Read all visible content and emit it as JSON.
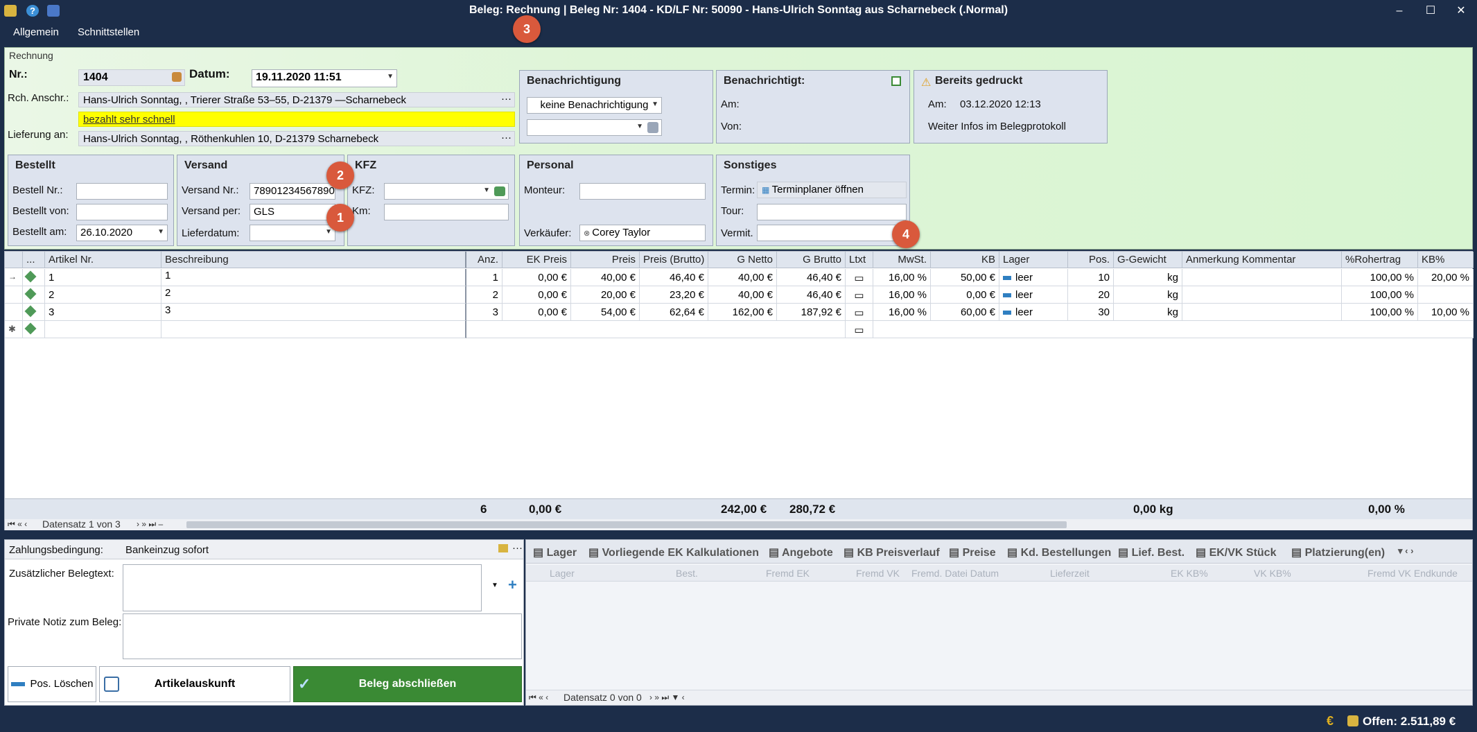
{
  "window": {
    "title": "Beleg: Rechnung | Beleg Nr: 1404 - KD/LF Nr: 50090 - Hans-Ulrich Sonntag aus Scharnebeck (.Normal)",
    "minimize": "–",
    "maximize": "☐",
    "close": "✕"
  },
  "menu": {
    "items": [
      "Allgemein",
      "Schnittstellen"
    ]
  },
  "badges": [
    "1",
    "2",
    "3",
    "4"
  ],
  "header": {
    "section_label": "Rechnung",
    "nr_label": "Nr.:",
    "nr_value": "1404",
    "datum_label": "Datum:",
    "datum_value": "19.11.2020 11:51",
    "rch_label": "Rch. Anschr.:",
    "rch_value": "Hans-Ulrich Sonntag, , Trierer Straße 53–55, D-21379 —Scharnebeck",
    "note_value": "bezahlt sehr schnell",
    "lieferung_label": "Lieferung an:",
    "lieferung_value": "Hans-Ulrich Sonntag, , Röthenkuhlen 10, D-21379 Scharnebeck",
    "ellipsis": "···"
  },
  "benachrichtigung": {
    "title": "Benachrichtigung",
    "select_value": "keine Benachrichtigung"
  },
  "benachrichtigt": {
    "title": "Benachrichtigt:",
    "am_label": "Am:",
    "von_label": "Von:"
  },
  "gedruckt": {
    "title": "Bereits gedruckt",
    "am_label": "Am:",
    "am_value": "03.12.2020 12:13",
    "info": "Weiter Infos im Belegprotokoll"
  },
  "bestellt": {
    "title": "Bestellt",
    "nr_label": "Bestell Nr.:",
    "von_label": "Bestellt von:",
    "am_label": "Bestellt am:",
    "am_value": "26.10.2020"
  },
  "versand": {
    "title": "Versand",
    "nr_label": "Versand Nr.:",
    "nr_value": "78901234567890",
    "per_label": "Versand per:",
    "per_value": "GLS",
    "liefer_label": "Lieferdatum:"
  },
  "kfz": {
    "title": "KFZ",
    "kfz_label": "KFZ:",
    "km_label": "Km:"
  },
  "personal": {
    "title": "Personal",
    "monteur_label": "Monteur:",
    "verkaeufer_label": "Verkäufer:",
    "verkaeufer_value": "Corey Taylor"
  },
  "sonstiges": {
    "title": "Sonstiges",
    "termin_label": "Termin:",
    "termin_value": "Terminplaner öffnen",
    "tour_label": "Tour:",
    "vermit_label": "Vermit."
  },
  "grid": {
    "columns": [
      "...",
      "Artikel Nr.",
      "Beschreibung",
      "Anz.",
      "EK Preis",
      "Preis",
      "Preis (Brutto)",
      "G Netto",
      "G Brutto",
      "Ltxt",
      "MwSt.",
      "KB",
      "Lager",
      "Pos.",
      "G-Gewicht",
      "Anmerkung Kommentar",
      "%Rohertrag",
      "KB%"
    ],
    "rows": [
      {
        "artikel": "1",
        "beschreibung": "1",
        "anz": "1",
        "ek": "0,00 €",
        "preis": "40,00 €",
        "brutto": "46,40 €",
        "gnetto": "40,00 €",
        "gbrutto": "46,40 €",
        "mwst": "16,00 %",
        "kb": "50,00 €",
        "lager": "leer",
        "pos": "10",
        "gewicht": "kg",
        "roh": "100,00 %",
        "kbp": "20,00 %"
      },
      {
        "artikel": "2",
        "beschreibung": "2",
        "anz": "2",
        "ek": "0,00 €",
        "preis": "20,00 €",
        "brutto": "23,20 €",
        "gnetto": "40,00 €",
        "gbrutto": "46,40 €",
        "mwst": "16,00 %",
        "kb": "0,00 €",
        "lager": "leer",
        "pos": "20",
        "gewicht": "kg",
        "roh": "100,00 %",
        "kbp": ""
      },
      {
        "artikel": "3",
        "beschreibung": "3",
        "anz": "3",
        "ek": "0,00 €",
        "preis": "54,00 €",
        "brutto": "62,64 €",
        "gnetto": "162,00 €",
        "gbrutto": "187,92 €",
        "mwst": "16,00 %",
        "kb": "60,00 €",
        "lager": "leer",
        "pos": "30",
        "gewicht": "kg",
        "roh": "100,00 %",
        "kbp": "10,00 %"
      }
    ],
    "totals": {
      "anz": "6",
      "ek": "0,00 €",
      "gnetto": "242,00 €",
      "gbrutto": "280,72 €",
      "gewicht": "0,00 kg",
      "roh": "0,00 %"
    },
    "nav_text": "Datensatz 1 von 3"
  },
  "bottom": {
    "zahlung_label": "Zahlungsbedingung:",
    "zahlung_value": "Bankeinzug sofort",
    "belegtext_label": "Zusätzlicher Belegtext:",
    "notiz_label": "Private Notiz zum Beleg:",
    "btn_loeschen": "Pos. Löschen",
    "btn_artikel": "Artikelauskunft",
    "btn_abschliessen": "Beleg abschließen"
  },
  "tabs": [
    "Lager",
    "Vorliegende EK Kalkulationen",
    "Angebote",
    "KB Preisverlauf",
    "Preise",
    "Kd. Bestellungen",
    "Lief. Best.",
    "EK/VK Stück",
    "Platzierung(en)"
  ],
  "subgrid": {
    "columns": [
      "Lager",
      "Best.",
      "Fremd EK",
      "Fremd VK",
      "Fremd. Datei Datum",
      "Lieferzeit",
      "EK KB%",
      "VK KB%",
      "Fremd VK Endkunde"
    ],
    "nav_text": "Datensatz 0 von 0"
  },
  "status": {
    "offen": "Offen: 2.511,89 €",
    "euro": "€"
  },
  "colors": {
    "titlebar": "#1c2d49",
    "header_bg": "#dff5d8",
    "note_bg": "#ffff00",
    "accent_green": "#3a8a34",
    "badge": "#d9593c"
  }
}
